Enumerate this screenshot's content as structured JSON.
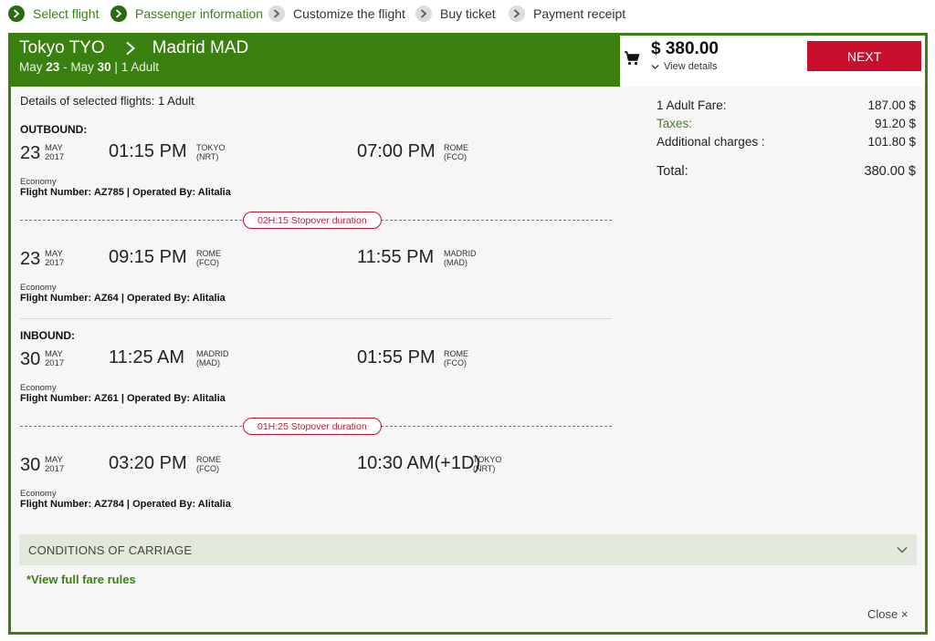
{
  "steps": [
    {
      "label": "Select flight",
      "state": "done"
    },
    {
      "label": "Passenger information",
      "state": "done"
    },
    {
      "label": "Customize the flight",
      "state": "todo"
    },
    {
      "label": "Buy ticket",
      "state": "todo"
    },
    {
      "label": "Payment receipt",
      "state": "todo"
    }
  ],
  "header": {
    "origin": "Tokyo TYO",
    "destination": "Madrid MAD",
    "date_from_month": "May",
    "date_from_day": "23",
    "date_sep": "-",
    "date_to_month": "May",
    "date_to_day": "30",
    "pax_sep": "|",
    "pax": "1 Adult"
  },
  "cart": {
    "price": "$ 380.00",
    "view_details": "View details",
    "next_label": "NEXT"
  },
  "fare": {
    "adult_label": "1 Adult Fare:",
    "adult_value": "187.00 $",
    "taxes_label": "Taxes:",
    "taxes_value": "91.20 $",
    "additional_label": "Additional charges :",
    "additional_value": "101.80 $",
    "total_label": "Total:",
    "total_value": "380.00 $"
  },
  "details": {
    "title": "Details of selected flights: 1 Adult",
    "outbound_label": "OUTBOUND:",
    "inbound_label": "INBOUND:",
    "segments": [
      {
        "day": "23",
        "month": "MAY",
        "year": "2017",
        "dep_time": "01:15 PM",
        "dep_city": "TOKYO",
        "dep_code": "(NRT)",
        "arr_time": "07:00 PM",
        "arr_city": "ROME",
        "arr_code": "(FCO)",
        "cabin": "Economy",
        "flight": "Flight Number: AZ785 | Operated By: Alitalia"
      },
      {
        "day": "23",
        "month": "MAY",
        "year": "2017",
        "dep_time": "09:15 PM",
        "dep_city": "ROME",
        "dep_code": "(FCO)",
        "arr_time": "11:55 PM",
        "arr_city": "MADRID",
        "arr_code": "(MAD)",
        "cabin": "Economy",
        "flight": "Flight Number: AZ64 | Operated By: Alitalia"
      },
      {
        "day": "30",
        "month": "MAY",
        "year": "2017",
        "dep_time": "11:25 AM",
        "dep_city": "MADRID",
        "dep_code": "(MAD)",
        "arr_time": "01:55 PM",
        "arr_city": "ROME",
        "arr_code": "(FCO)",
        "cabin": "Economy",
        "flight": "Flight Number: AZ61 | Operated By: Alitalia"
      },
      {
        "day": "30",
        "month": "MAY",
        "year": "2017",
        "dep_time": "03:20 PM",
        "dep_city": "ROME",
        "dep_code": "(FCO)",
        "arr_time": "10:30 AM(+1D)",
        "arr_city": "TOKYO",
        "arr_code": "(NRT)",
        "cabin": "Economy",
        "flight": "Flight Number: AZ784 | Operated By: Alitalia"
      }
    ],
    "stopovers": [
      "02H:15 Stopover duration",
      "01H:25 Stopover duration"
    ]
  },
  "conditions_label": "CONDITIONS OF CARRIAGE",
  "full_rules_link": "*View full fare rules",
  "close_label": "Close ×",
  "colors": {
    "brand_green": "#3a8011",
    "next_red": "#c8102e",
    "condition_bg": "#e1e8dc"
  }
}
